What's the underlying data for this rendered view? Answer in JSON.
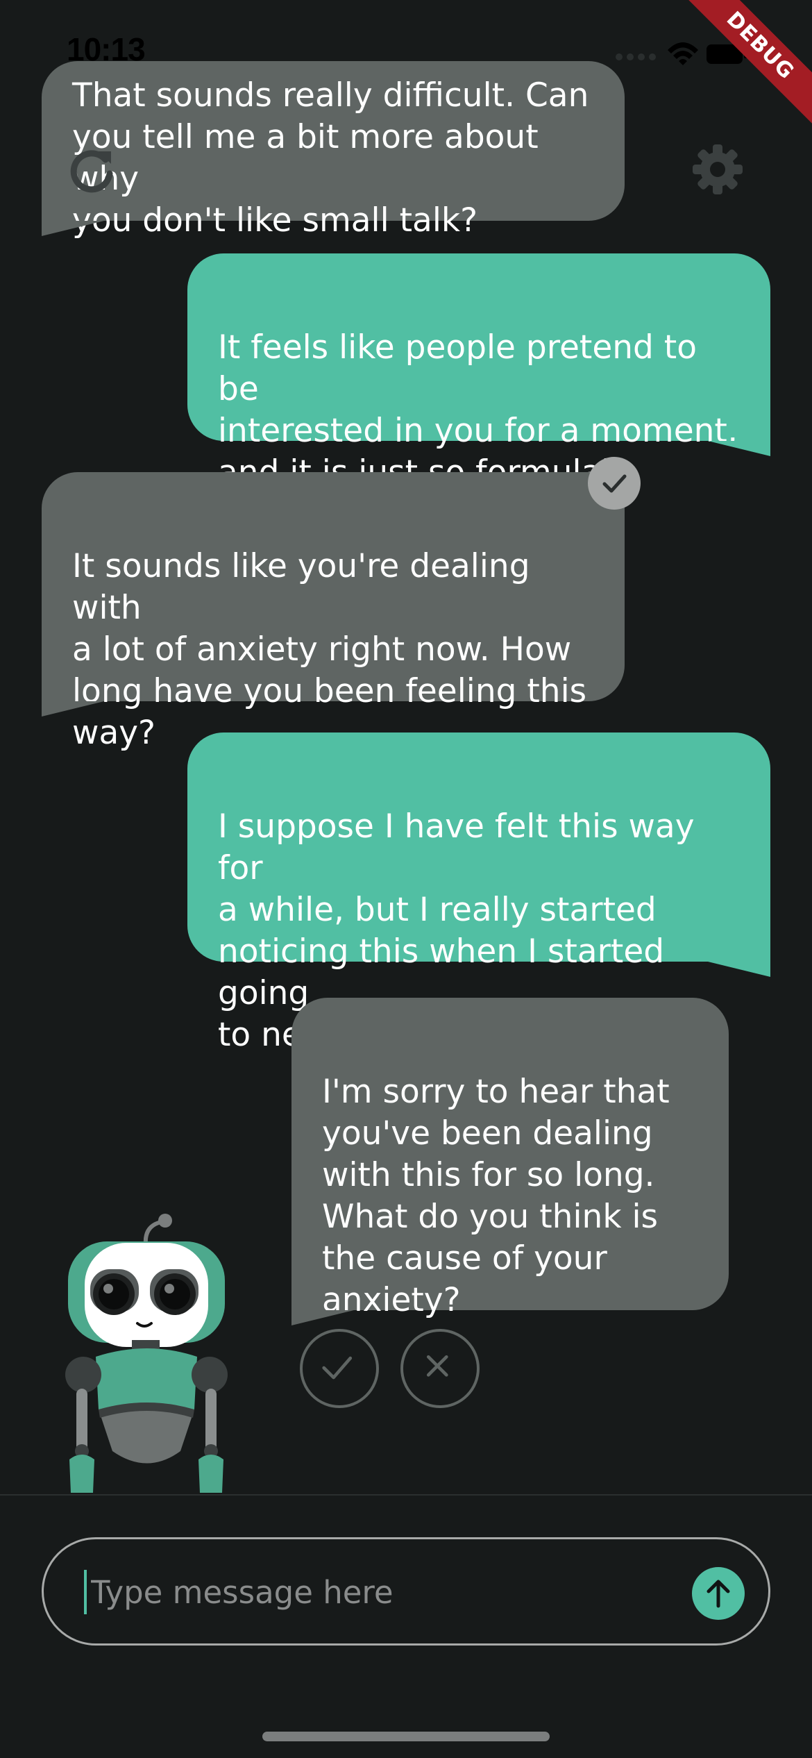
{
  "status_bar": {
    "time": "10:13"
  },
  "debug_banner": "DEBUG",
  "messages": [
    {
      "sender": "bot",
      "text": "That sounds really difficult. Can\nyou tell me a bit more about why\nyou don't like small talk?"
    },
    {
      "sender": "user",
      "text": "It feels like people pretend to be\ninterested in you for a moment,\nand it is just so formulaic"
    },
    {
      "sender": "bot",
      "text": "It sounds like you're dealing with\na lot of anxiety right now. How\nlong have you been feeling this\nway?"
    },
    {
      "sender": "user",
      "text": "I suppose I have felt this way for\na while, but I really started\nnoticing this when I started going\nto networking events"
    },
    {
      "sender": "bot",
      "text": "I'm sorry to hear that\nyou've been dealing\nwith this for so long.\nWhat do you think is\nthe cause of your\nanxiety?"
    }
  ],
  "icons": {
    "reload": "reload-icon",
    "settings": "gear-icon",
    "accepted": "check-icon",
    "accept": "check-icon",
    "reject": "close-icon",
    "send": "arrow-up-icon"
  },
  "composer": {
    "placeholder": "Type message here",
    "value": ""
  },
  "colors": {
    "background": "#171a1a",
    "bot_bubble": "#5f6563",
    "user_bubble": "#51bfa3",
    "accent": "#51bfa3",
    "debug_banner": "#a31d24"
  }
}
